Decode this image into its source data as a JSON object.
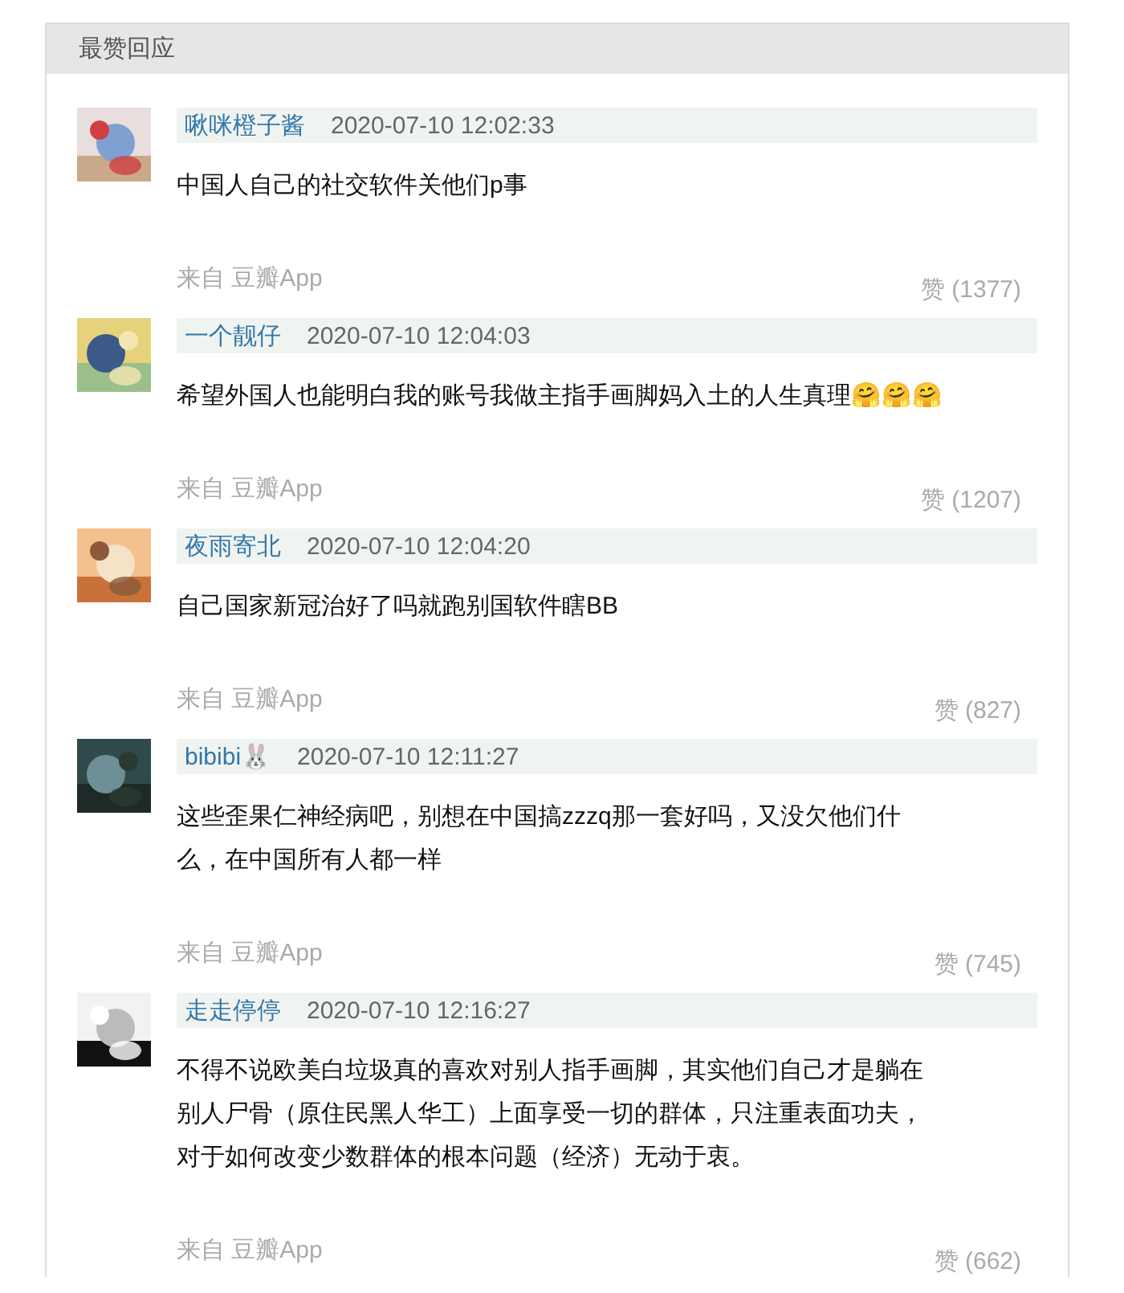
{
  "section": {
    "title": "最赞回应"
  },
  "comments": [
    {
      "avatar": {
        "kind": "picture"
      },
      "author": "啾咪橙子酱",
      "time": "2020-07-10 12:02:33",
      "text": [
        "中国人自己的社交软件关他们p事"
      ],
      "source": "来自 豆瓣App",
      "likes": "赞 (1377)"
    },
    {
      "avatar": {
        "kind": "picture"
      },
      "author": "一个靓仔",
      "time": "2020-07-10 12:04:03",
      "text": [
        "希望外国人也能明白我的账号我做主指手画脚妈入土的人生真理🤗🤗🤗"
      ],
      "source": "来自 豆瓣App",
      "likes": "赞 (1207)"
    },
    {
      "avatar": {
        "kind": "picture"
      },
      "author": "夜雨寄北",
      "time": "2020-07-10 12:04:20",
      "text": [
        "自己国家新冠治好了吗就跑别国软件瞎BB"
      ],
      "source": "来自 豆瓣App",
      "likes": "赞 (827)"
    },
    {
      "avatar": {
        "kind": "picture"
      },
      "author": "bibibi🐰",
      "time": "2020-07-10 12:11:27",
      "text": [
        "这些歪果仁神经病吧，别想在中国搞zzzq那一套好吗，又没欠他们什",
        "么，在中国所有人都一样"
      ],
      "source": "来自 豆瓣App",
      "likes": "赞 (745)"
    },
    {
      "avatar": {
        "kind": "picture"
      },
      "author": "走走停停",
      "time": "2020-07-10 12:16:27",
      "text": [
        "不得不说欧美白垃圾真的喜欢对别人指手画脚，其实他们自己才是躺在",
        "别人尸骨（原住民黑人华工）上面享受一切的群体，只注重表面功夫，",
        "对于如何改变少数群体的根本问题（经济）无动于衷。"
      ],
      "source": "来自 豆瓣App",
      "likes": "赞 (662)"
    }
  ]
}
